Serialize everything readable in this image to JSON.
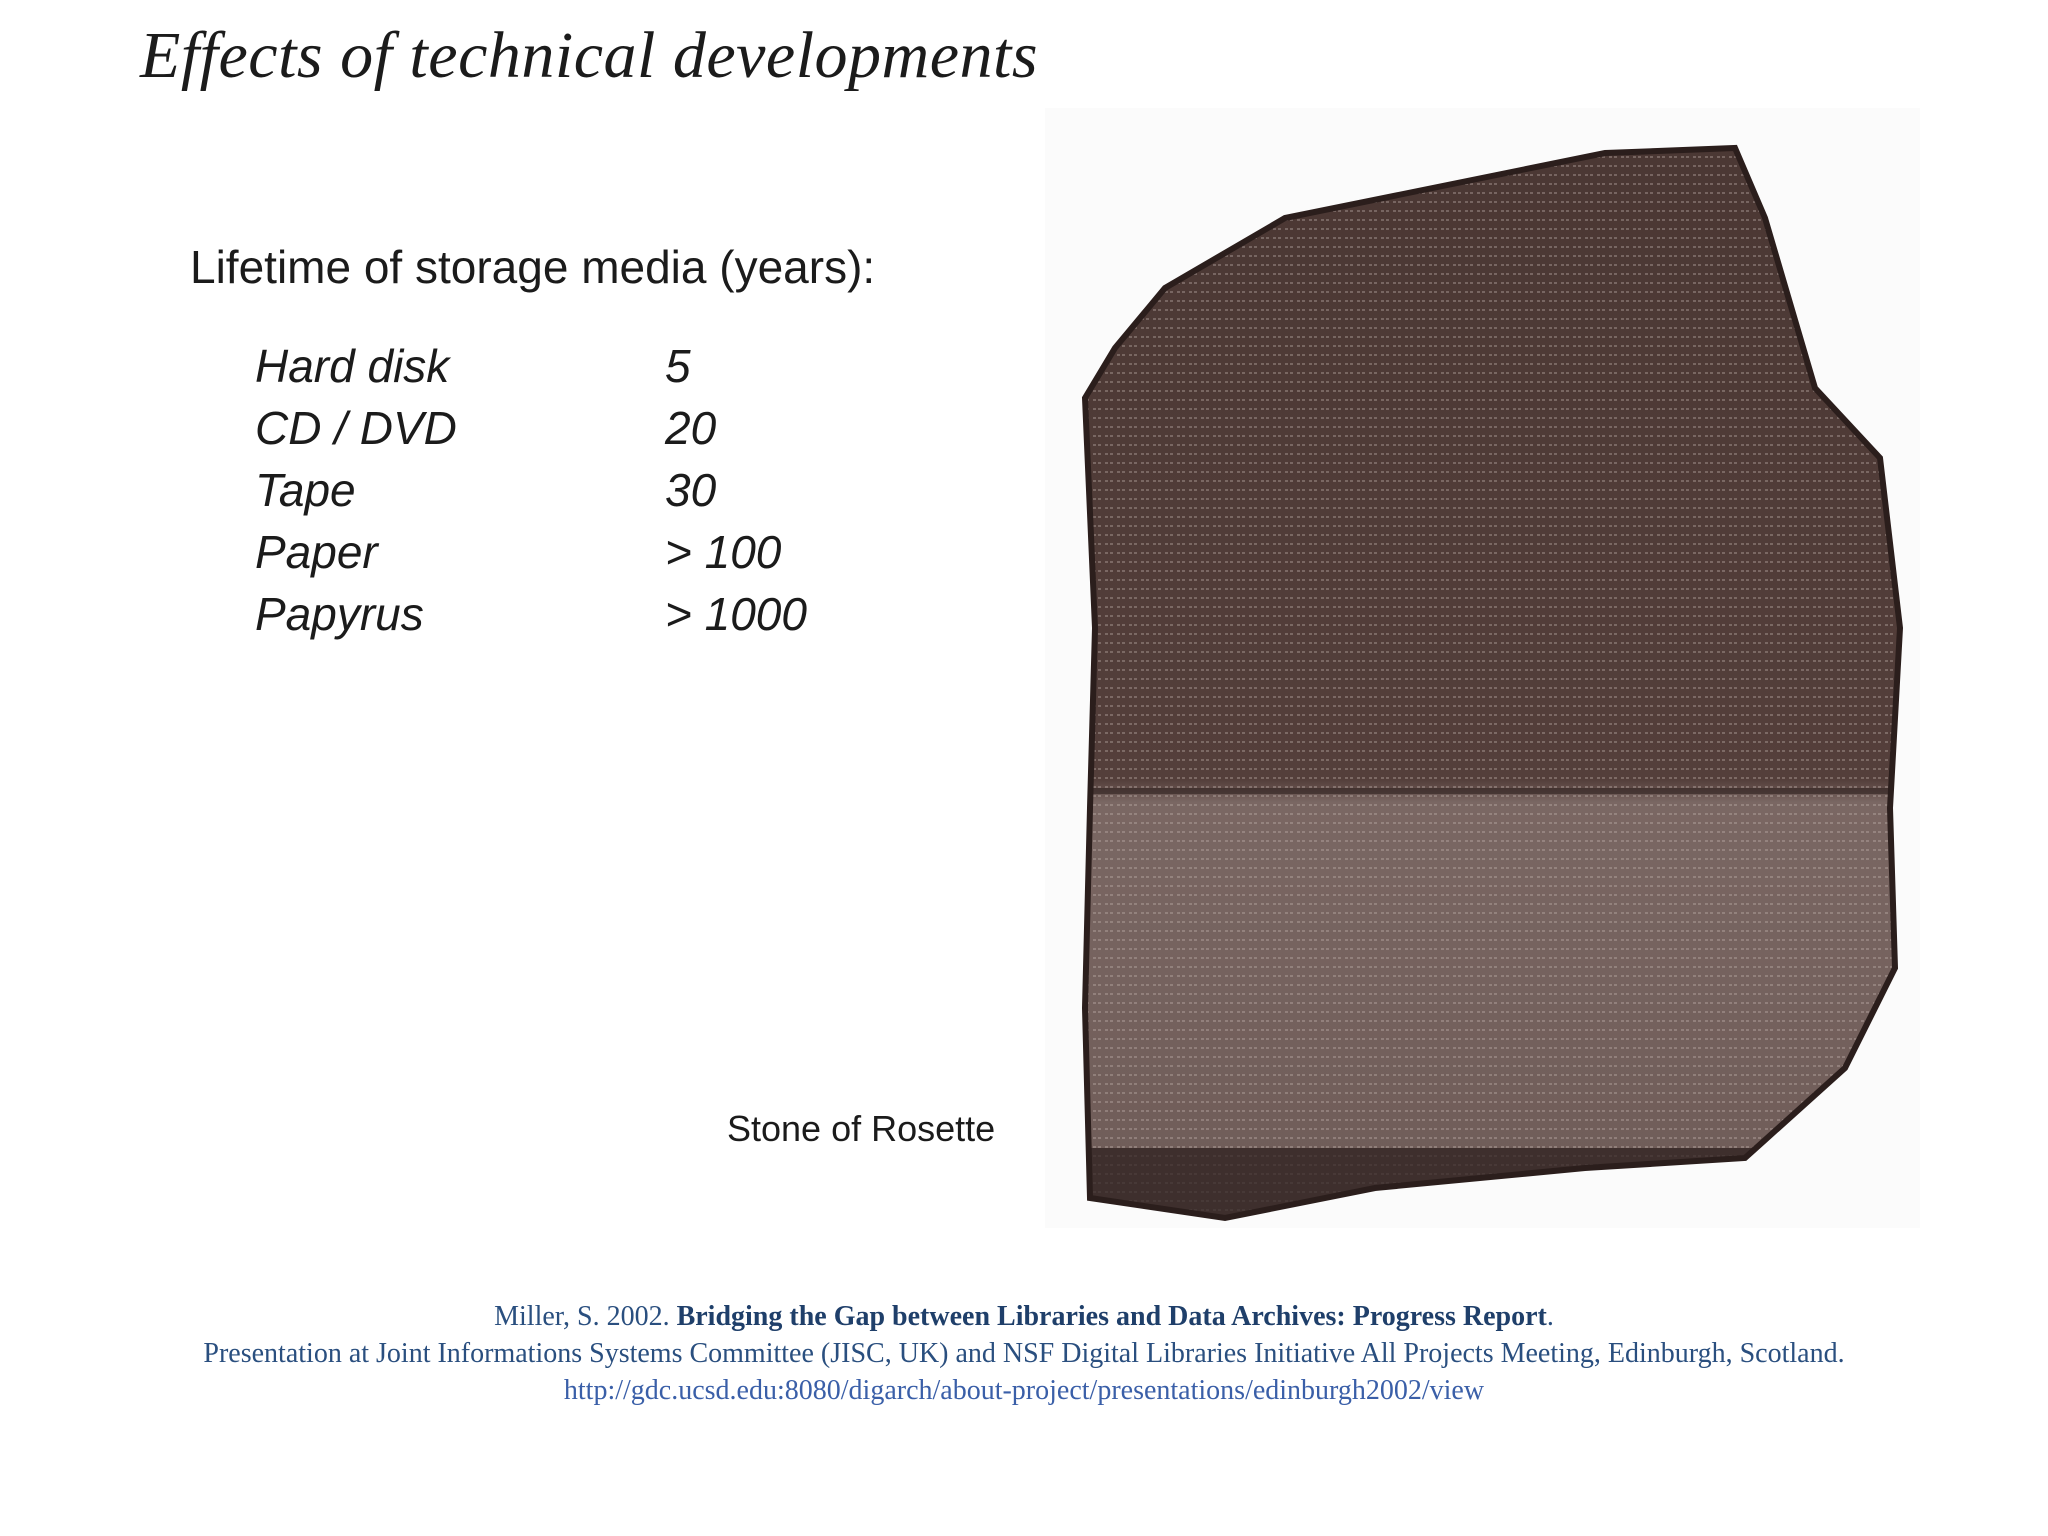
{
  "slide": {
    "title": "Effects of technical developments",
    "heading": "Lifetime of storage media (years):",
    "media": [
      {
        "name": "Hard disk",
        "years": "5"
      },
      {
        "name": "CD / DVD",
        "years": "20"
      },
      {
        "name": "Tape",
        "years": "30"
      },
      {
        "name": "Paper",
        "years": "> 100"
      },
      {
        "name": "Papyrus",
        "years": "> 1000"
      }
    ],
    "image_caption": "Stone of Rosette"
  },
  "citation": {
    "author_year": "Miller, S. 2002. ",
    "report_title": "Bridging the Gap between Libraries and Data Archives: Progress Report",
    "period": ".",
    "venue": "Presentation at Joint Informations Systems Committee (JISC, UK) and NSF Digital Libraries Initiative All Projects Meeting, Edinburgh, Scotland.",
    "url": "http://gdc.ucsd.edu:8080/digarch/about-project/presentations/edinburgh2002/view"
  },
  "colors": {
    "stone": "#5c4742",
    "stone_upper": "#4f3b37",
    "stone_lower": "#7a6763",
    "citation_text": "#2a4f7f"
  }
}
